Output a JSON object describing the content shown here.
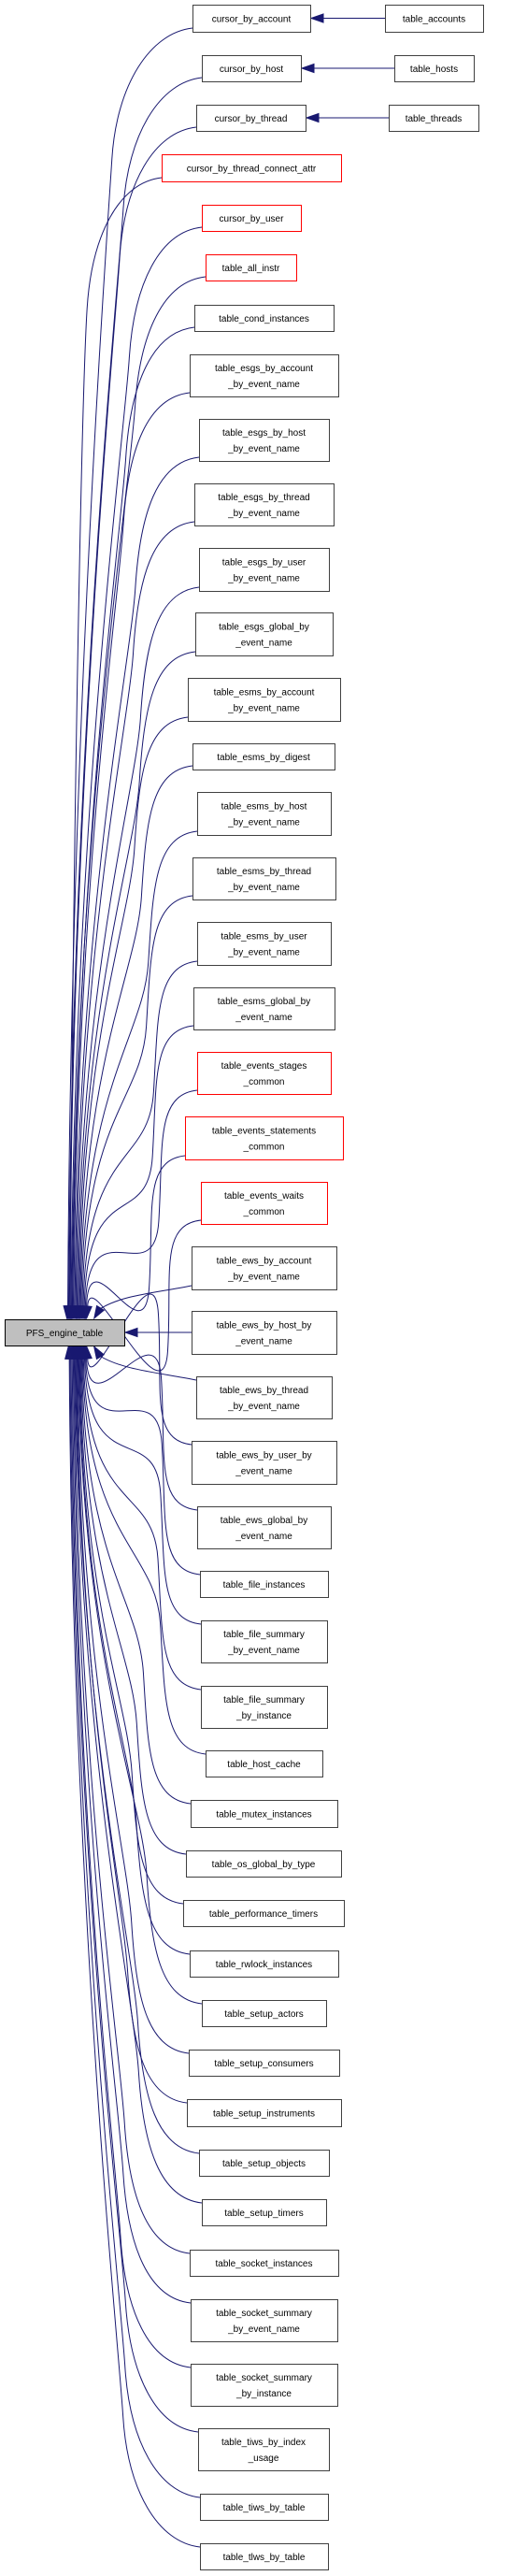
{
  "graph": {
    "type": "doxygen-inheritance-graph",
    "edge_color": "#191970",
    "root": {
      "id": "PFS_engine_table",
      "label": [
        "PFS_engine_table"
      ],
      "style": "root"
    },
    "nodes": [
      {
        "id": "cursor_by_account",
        "label": [
          "cursor_by_account"
        ],
        "style": "normal",
        "parent": "PFS_engine_table"
      },
      {
        "id": "cursor_by_host",
        "label": [
          "cursor_by_host"
        ],
        "style": "normal",
        "parent": "PFS_engine_table"
      },
      {
        "id": "cursor_by_thread",
        "label": [
          "cursor_by_thread"
        ],
        "style": "normal",
        "parent": "PFS_engine_table"
      },
      {
        "id": "cursor_by_thread_connect_attr",
        "label": [
          "cursor_by_thread_connect_attr"
        ],
        "style": "red",
        "parent": "PFS_engine_table"
      },
      {
        "id": "cursor_by_user",
        "label": [
          "cursor_by_user"
        ],
        "style": "red",
        "parent": "PFS_engine_table"
      },
      {
        "id": "table_all_instr",
        "label": [
          "table_all_instr"
        ],
        "style": "red",
        "parent": "PFS_engine_table"
      },
      {
        "id": "table_cond_instances",
        "label": [
          "table_cond_instances"
        ],
        "style": "normal",
        "parent": "PFS_engine_table"
      },
      {
        "id": "table_esgs_by_account_by_event_name",
        "label": [
          "table_esgs_by_account",
          "_by_event_name"
        ],
        "style": "normal",
        "parent": "PFS_engine_table"
      },
      {
        "id": "table_esgs_by_host_by_event_name",
        "label": [
          "table_esgs_by_host",
          "_by_event_name"
        ],
        "style": "normal",
        "parent": "PFS_engine_table"
      },
      {
        "id": "table_esgs_by_thread_by_event_name",
        "label": [
          "table_esgs_by_thread",
          "_by_event_name"
        ],
        "style": "normal",
        "parent": "PFS_engine_table"
      },
      {
        "id": "table_esgs_by_user_by_event_name",
        "label": [
          "table_esgs_by_user",
          "_by_event_name"
        ],
        "style": "normal",
        "parent": "PFS_engine_table"
      },
      {
        "id": "table_esgs_global_by_event_name",
        "label": [
          "table_esgs_global_by",
          "_event_name"
        ],
        "style": "normal",
        "parent": "PFS_engine_table"
      },
      {
        "id": "table_esms_by_account_by_event_name",
        "label": [
          "table_esms_by_account",
          "_by_event_name"
        ],
        "style": "normal",
        "parent": "PFS_engine_table"
      },
      {
        "id": "table_esms_by_digest",
        "label": [
          "table_esms_by_digest"
        ],
        "style": "normal",
        "parent": "PFS_engine_table"
      },
      {
        "id": "table_esms_by_host_by_event_name",
        "label": [
          "table_esms_by_host",
          "_by_event_name"
        ],
        "style": "normal",
        "parent": "PFS_engine_table"
      },
      {
        "id": "table_esms_by_thread_by_event_name",
        "label": [
          "table_esms_by_thread",
          "_by_event_name"
        ],
        "style": "normal",
        "parent": "PFS_engine_table"
      },
      {
        "id": "table_esms_by_user_by_event_name",
        "label": [
          "table_esms_by_user",
          "_by_event_name"
        ],
        "style": "normal",
        "parent": "PFS_engine_table"
      },
      {
        "id": "table_esms_global_by_event_name",
        "label": [
          "table_esms_global_by",
          "_event_name"
        ],
        "style": "normal",
        "parent": "PFS_engine_table"
      },
      {
        "id": "table_events_stages_common",
        "label": [
          "table_events_stages",
          "_common"
        ],
        "style": "red",
        "parent": "PFS_engine_table"
      },
      {
        "id": "table_events_statements_common",
        "label": [
          "table_events_statements",
          "_common"
        ],
        "style": "red",
        "parent": "PFS_engine_table"
      },
      {
        "id": "table_events_waits_common",
        "label": [
          "table_events_waits",
          "_common"
        ],
        "style": "red",
        "parent": "PFS_engine_table"
      },
      {
        "id": "table_ews_by_account_by_event_name",
        "label": [
          "table_ews_by_account",
          "_by_event_name"
        ],
        "style": "normal",
        "parent": "PFS_engine_table"
      },
      {
        "id": "table_ews_by_host_by_event_name",
        "label": [
          "table_ews_by_host_by",
          "_event_name"
        ],
        "style": "normal",
        "parent": "PFS_engine_table"
      },
      {
        "id": "table_ews_by_thread_by_event_name",
        "label": [
          "table_ews_by_thread",
          "_by_event_name"
        ],
        "style": "normal",
        "parent": "PFS_engine_table"
      },
      {
        "id": "table_ews_by_user_by_event_name",
        "label": [
          "table_ews_by_user_by",
          "_event_name"
        ],
        "style": "normal",
        "parent": "PFS_engine_table"
      },
      {
        "id": "table_ews_global_by_event_name",
        "label": [
          "table_ews_global_by",
          "_event_name"
        ],
        "style": "normal",
        "parent": "PFS_engine_table"
      },
      {
        "id": "table_file_instances",
        "label": [
          "table_file_instances"
        ],
        "style": "normal",
        "parent": "PFS_engine_table"
      },
      {
        "id": "table_file_summary_by_event_name",
        "label": [
          "table_file_summary",
          "_by_event_name"
        ],
        "style": "normal",
        "parent": "PFS_engine_table"
      },
      {
        "id": "table_file_summary_by_instance",
        "label": [
          "table_file_summary",
          "_by_instance"
        ],
        "style": "normal",
        "parent": "PFS_engine_table"
      },
      {
        "id": "table_host_cache",
        "label": [
          "table_host_cache"
        ],
        "style": "normal",
        "parent": "PFS_engine_table"
      },
      {
        "id": "table_mutex_instances",
        "label": [
          "table_mutex_instances"
        ],
        "style": "normal",
        "parent": "PFS_engine_table"
      },
      {
        "id": "table_os_global_by_type",
        "label": [
          "table_os_global_by_type"
        ],
        "style": "normal",
        "parent": "PFS_engine_table"
      },
      {
        "id": "table_performance_timers",
        "label": [
          "table_performance_timers"
        ],
        "style": "normal",
        "parent": "PFS_engine_table"
      },
      {
        "id": "table_rwlock_instances",
        "label": [
          "table_rwlock_instances"
        ],
        "style": "normal",
        "parent": "PFS_engine_table"
      },
      {
        "id": "table_setup_actors",
        "label": [
          "table_setup_actors"
        ],
        "style": "normal",
        "parent": "PFS_engine_table"
      },
      {
        "id": "table_setup_consumers",
        "label": [
          "table_setup_consumers"
        ],
        "style": "normal",
        "parent": "PFS_engine_table"
      },
      {
        "id": "table_setup_instruments",
        "label": [
          "table_setup_instruments"
        ],
        "style": "normal",
        "parent": "PFS_engine_table"
      },
      {
        "id": "table_setup_objects",
        "label": [
          "table_setup_objects"
        ],
        "style": "normal",
        "parent": "PFS_engine_table"
      },
      {
        "id": "table_setup_timers",
        "label": [
          "table_setup_timers"
        ],
        "style": "normal",
        "parent": "PFS_engine_table"
      },
      {
        "id": "table_socket_instances",
        "label": [
          "table_socket_instances"
        ],
        "style": "normal",
        "parent": "PFS_engine_table"
      },
      {
        "id": "table_socket_summary_by_event_name",
        "label": [
          "table_socket_summary",
          "_by_event_name"
        ],
        "style": "normal",
        "parent": "PFS_engine_table"
      },
      {
        "id": "table_socket_summary_by_instance",
        "label": [
          "table_socket_summary",
          "_by_instance"
        ],
        "style": "normal",
        "parent": "PFS_engine_table"
      },
      {
        "id": "table_tiws_by_index_usage",
        "label": [
          "table_tiws_by_index",
          "_usage"
        ],
        "style": "normal",
        "parent": "PFS_engine_table"
      },
      {
        "id": "table_tiws_by_table",
        "label": [
          "table_tiws_by_table"
        ],
        "style": "normal",
        "parent": "PFS_engine_table"
      },
      {
        "id": "table_tlws_by_table",
        "label": [
          "table_tlws_by_table"
        ],
        "style": "normal",
        "parent": "PFS_engine_table"
      },
      {
        "id": "table_accounts",
        "label": [
          "table_accounts"
        ],
        "style": "normal",
        "parent": "cursor_by_account"
      },
      {
        "id": "table_hosts",
        "label": [
          "table_hosts"
        ],
        "style": "normal",
        "parent": "cursor_by_host"
      },
      {
        "id": "table_threads",
        "label": [
          "table_threads"
        ],
        "style": "normal",
        "parent": "cursor_by_thread"
      }
    ]
  }
}
